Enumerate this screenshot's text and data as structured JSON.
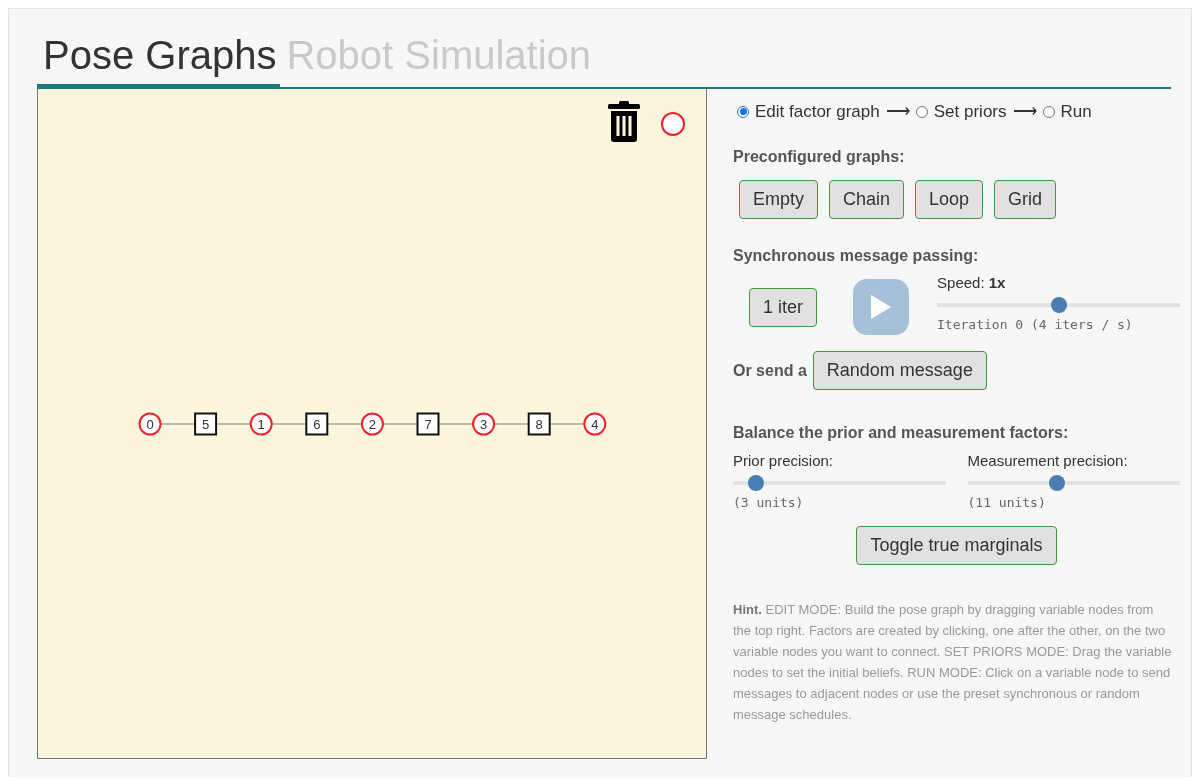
{
  "tabs": [
    {
      "label": "Pose Graphs",
      "selected": true
    },
    {
      "label": "Robot Simulation",
      "selected": false
    }
  ],
  "graph": {
    "nodes": [
      {
        "label": "0",
        "kind": "variable"
      },
      {
        "label": "5",
        "kind": "factor"
      },
      {
        "label": "1",
        "kind": "variable"
      },
      {
        "label": "6",
        "kind": "factor"
      },
      {
        "label": "2",
        "kind": "variable"
      },
      {
        "label": "7",
        "kind": "factor"
      },
      {
        "label": "3",
        "kind": "variable"
      },
      {
        "label": "8",
        "kind": "factor"
      },
      {
        "label": "4",
        "kind": "variable"
      }
    ]
  },
  "modes": [
    {
      "label": "Edit factor graph",
      "arrow": "⟶",
      "selected": true
    },
    {
      "label": "Set priors",
      "arrow": "⟶",
      "selected": false
    },
    {
      "label": "Run",
      "selected": false
    }
  ],
  "preconfigured": {
    "heading": "Preconfigured graphs:",
    "buttons": [
      "Empty",
      "Chain",
      "Loop",
      "Grid"
    ]
  },
  "sync": {
    "heading": "Synchronous message passing:",
    "step_button": "1 iter",
    "speed_label": "Speed:",
    "speed_value": "1x",
    "speed": {
      "level": 0.5
    },
    "iteration": "Iteration 0 (4 iters / s)"
  },
  "random": {
    "label": "Or send a",
    "button": "Random message"
  },
  "balance": {
    "heading": "Balance the prior and measurement factors:",
    "sliders": [
      {
        "label": "Prior precision:",
        "level": 0.11,
        "reading": "(3 units)"
      },
      {
        "label": "Measurement precision:",
        "level": 0.42,
        "reading": "(11 units)"
      }
    ]
  },
  "toggle_button": "Toggle true marginals",
  "hint": "**Hint.** EDIT MODE: Build the pose graph by dragging variable nodes from the top right. Factors are created by clicking, one after the other, on the two variable nodes you want to connect. SET PRIORS MODE: Drag the variable nodes to set the initial beliefs. RUN MODE: Click on a variable node to send messages to adjacent nodes or use the preset synchronous or random message schedules."
}
